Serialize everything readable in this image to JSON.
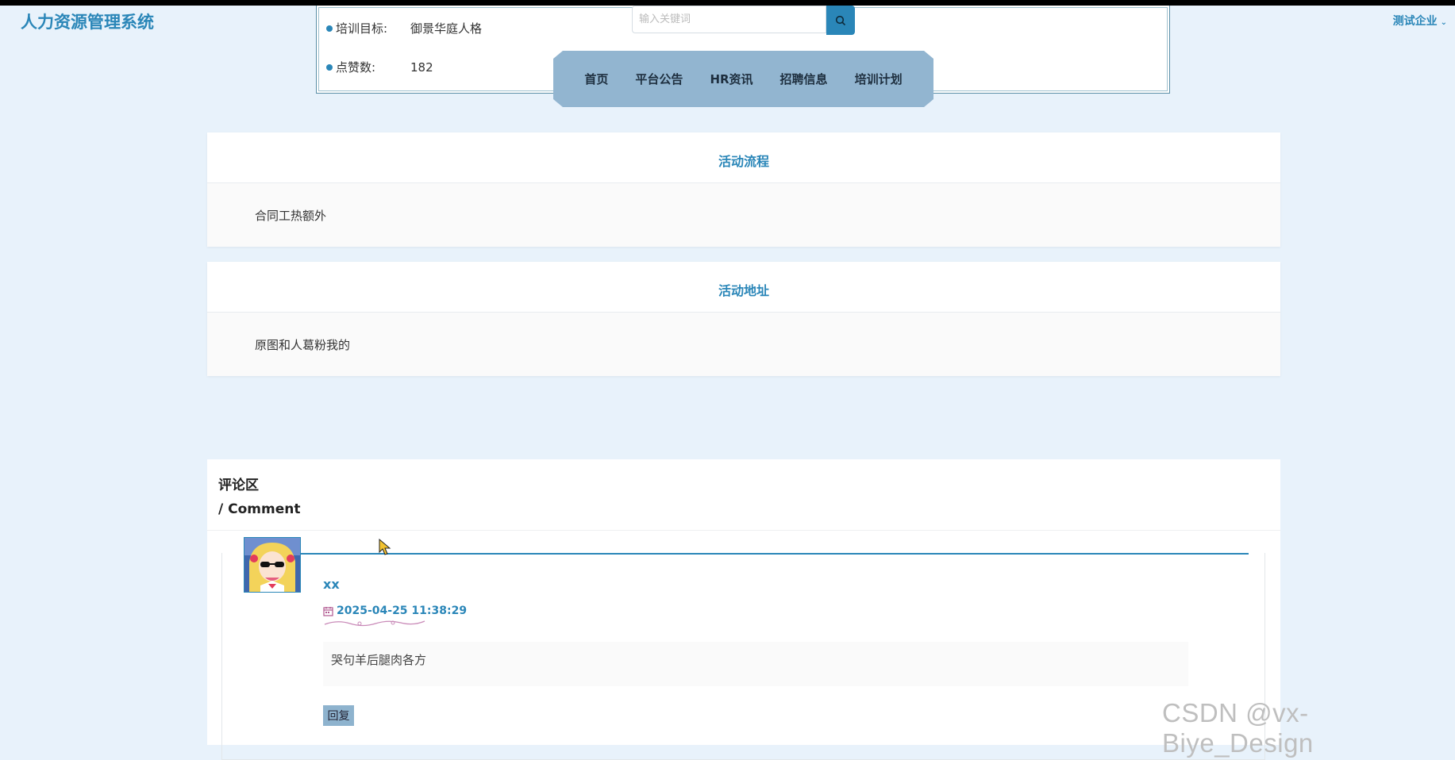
{
  "app": {
    "brand": "人力资源管理系统",
    "user_menu": "测试企业"
  },
  "info": {
    "rows": [
      {
        "label": "培训目标:",
        "value": "御景华庭人格"
      },
      {
        "label": "点赞数:",
        "value": "182"
      }
    ]
  },
  "search": {
    "placeholder": "输入关键词"
  },
  "nav": {
    "items": [
      "首页",
      "平台公告",
      "HR资讯",
      "招聘信息",
      "培训计划"
    ]
  },
  "sections": {
    "flow": {
      "title": "活动流程",
      "content": "合同工热额外"
    },
    "address": {
      "title": "活动地址",
      "content": "原图和人葛粉我的"
    }
  },
  "comments": {
    "title": "评论区",
    "subtitle": "/ Comment",
    "items": [
      {
        "user": "xx",
        "time": "2025-04-25 11:38:29",
        "text": "哭句羊后腿肉各方",
        "reply_label": "回复"
      }
    ]
  },
  "watermark": "CSDN @vx-Biye_Design",
  "colors": {
    "accent": "#2a86b8",
    "nav_bg": "#92b5d0",
    "page_bg": "#e8f2fb"
  }
}
